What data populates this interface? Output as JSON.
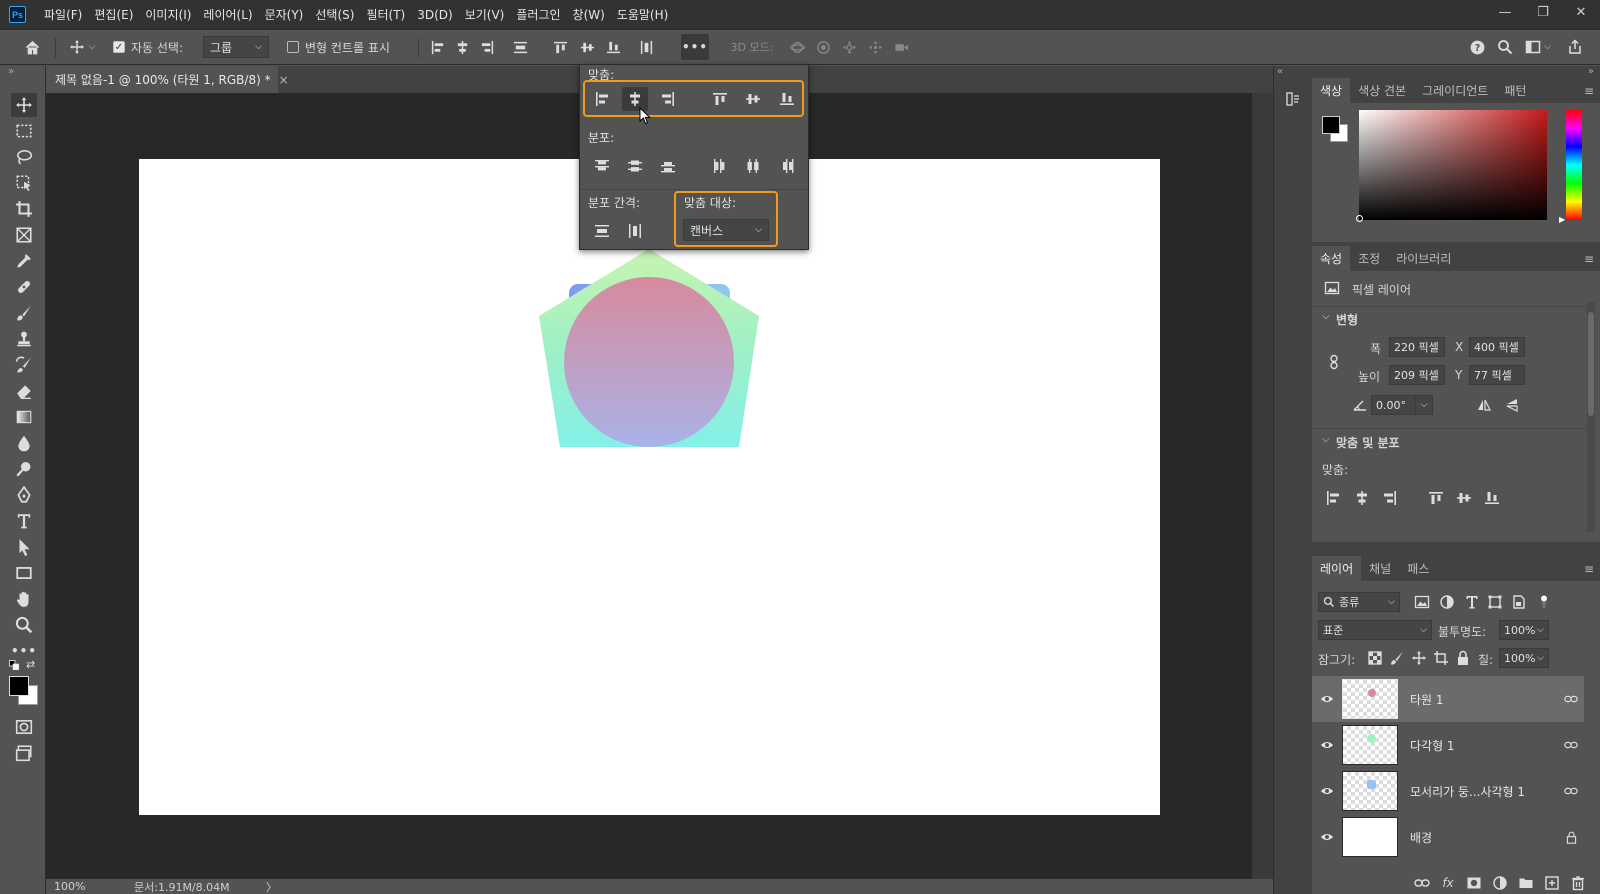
{
  "app": {
    "logo": "Ps"
  },
  "menu": [
    "파일(F)",
    "편집(E)",
    "이미지(I)",
    "레이어(L)",
    "문자(Y)",
    "선택(S)",
    "필터(T)",
    "3D(D)",
    "보기(V)",
    "플러그인",
    "창(W)",
    "도움말(H)"
  ],
  "window_controls": {
    "minimize": "—",
    "restore": "❐",
    "close": "✕"
  },
  "options": {
    "auto_select_label": "자동 선택:",
    "auto_select_checked": true,
    "auto_select_target": "그룹",
    "transform_controls_label": "변형 컨트롤 표시",
    "transform_controls_checked": false,
    "more_label": "•••",
    "mode_3d_label": "3D 모드:"
  },
  "document": {
    "tab_title": "제목 없음-1 @ 100% (타원 1, RGB/8) *",
    "close_label": "×",
    "zoom": "100%",
    "doc_info": "문서:1.91M/8.04M",
    "status_arrow": "〉"
  },
  "align_popup": {
    "align_label": "맞춤:",
    "distribute_label": "분포:",
    "spacing_label": "분포 간격:",
    "align_to_label": "맞춤 대상:",
    "align_to_value": "캔버스",
    "highlight_color": "#f29a1b"
  },
  "color_panel": {
    "tabs": [
      "색상",
      "색상 견본",
      "그레이디언트",
      "패턴"
    ],
    "active_tab": 0,
    "foreground": "#000000",
    "background": "#ffffff",
    "hue_color": "#c41a1a"
  },
  "properties_panel": {
    "tabs": [
      "속성",
      "조정",
      "라이브러리"
    ],
    "active_tab": 0,
    "layer_type": "픽셀 레이어",
    "transform_title": "변형",
    "width_label": "폭",
    "width_value": "220 픽셀",
    "height_label": "높이",
    "height_value": "209 픽셀",
    "x_label": "X",
    "x_value": "400 픽셀",
    "y_label": "Y",
    "y_value": "77 픽셀",
    "angle_value": "0.00°",
    "align_section_title": "맞춤 및 분포",
    "align_label": "맞춤:"
  },
  "layers_panel": {
    "tabs": [
      "레이어",
      "채널",
      "패스"
    ],
    "active_tab": 0,
    "filter_label": "종류",
    "blend_mode": "표준",
    "opacity_label": "불투명도:",
    "opacity_value": "100%",
    "lock_label": "잠그기:",
    "fill_label": "칠:",
    "fill_value": "100%",
    "layers": [
      {
        "name": "타원 1",
        "selected": true,
        "dot_color": "#d88a9c",
        "end_icon": "link-icon"
      },
      {
        "name": "다각형 1",
        "selected": false,
        "dot_color": "#9ff0c6",
        "end_icon": "link-icon"
      },
      {
        "name": "모서리가 둥...사각형 1",
        "selected": false,
        "dot_color": "#9cc0f0",
        "end_icon": "link-icon"
      },
      {
        "name": "배경",
        "selected": false,
        "dot_color": "",
        "end_icon": "lock-icon"
      }
    ]
  },
  "canvas_shapes": {
    "rounded_rect_gradient": [
      "#7f9af0",
      "#8ec8f0"
    ],
    "pentagon_gradient": [
      "#c8f4b0",
      "#9ff0c6",
      "#84f0e8"
    ],
    "circle_gradient": [
      "#d88a9c",
      "#a9b2e8"
    ]
  }
}
